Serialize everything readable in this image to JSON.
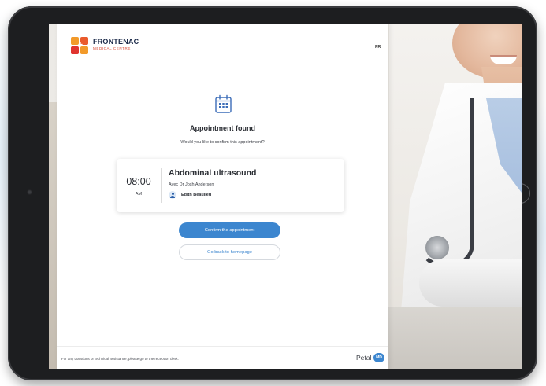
{
  "header": {
    "brand_name": "FRONTENAC",
    "brand_sub": "MEDICAL CENTRE",
    "lang": "FR"
  },
  "main": {
    "title": "Appointment found",
    "question": "Would you like to confirm this appointment?"
  },
  "appointment": {
    "time": "08:00",
    "ampm": "AM",
    "service": "Abdominal ultrasound",
    "doctor": "Avec Dr Josh Anderson",
    "patient": "Edith Beaulieu"
  },
  "buttons": {
    "confirm": "Confirm the appointment",
    "back": "Go back to homepage"
  },
  "footer": {
    "text": "For any questions or technical assistance, please go to the reception desk.",
    "brand": "Petal",
    "brand_badge": "MD"
  },
  "colors": {
    "accent": "#3c86cf",
    "logo_orange": "#f29a2a",
    "logo_red": "#e0342f"
  }
}
